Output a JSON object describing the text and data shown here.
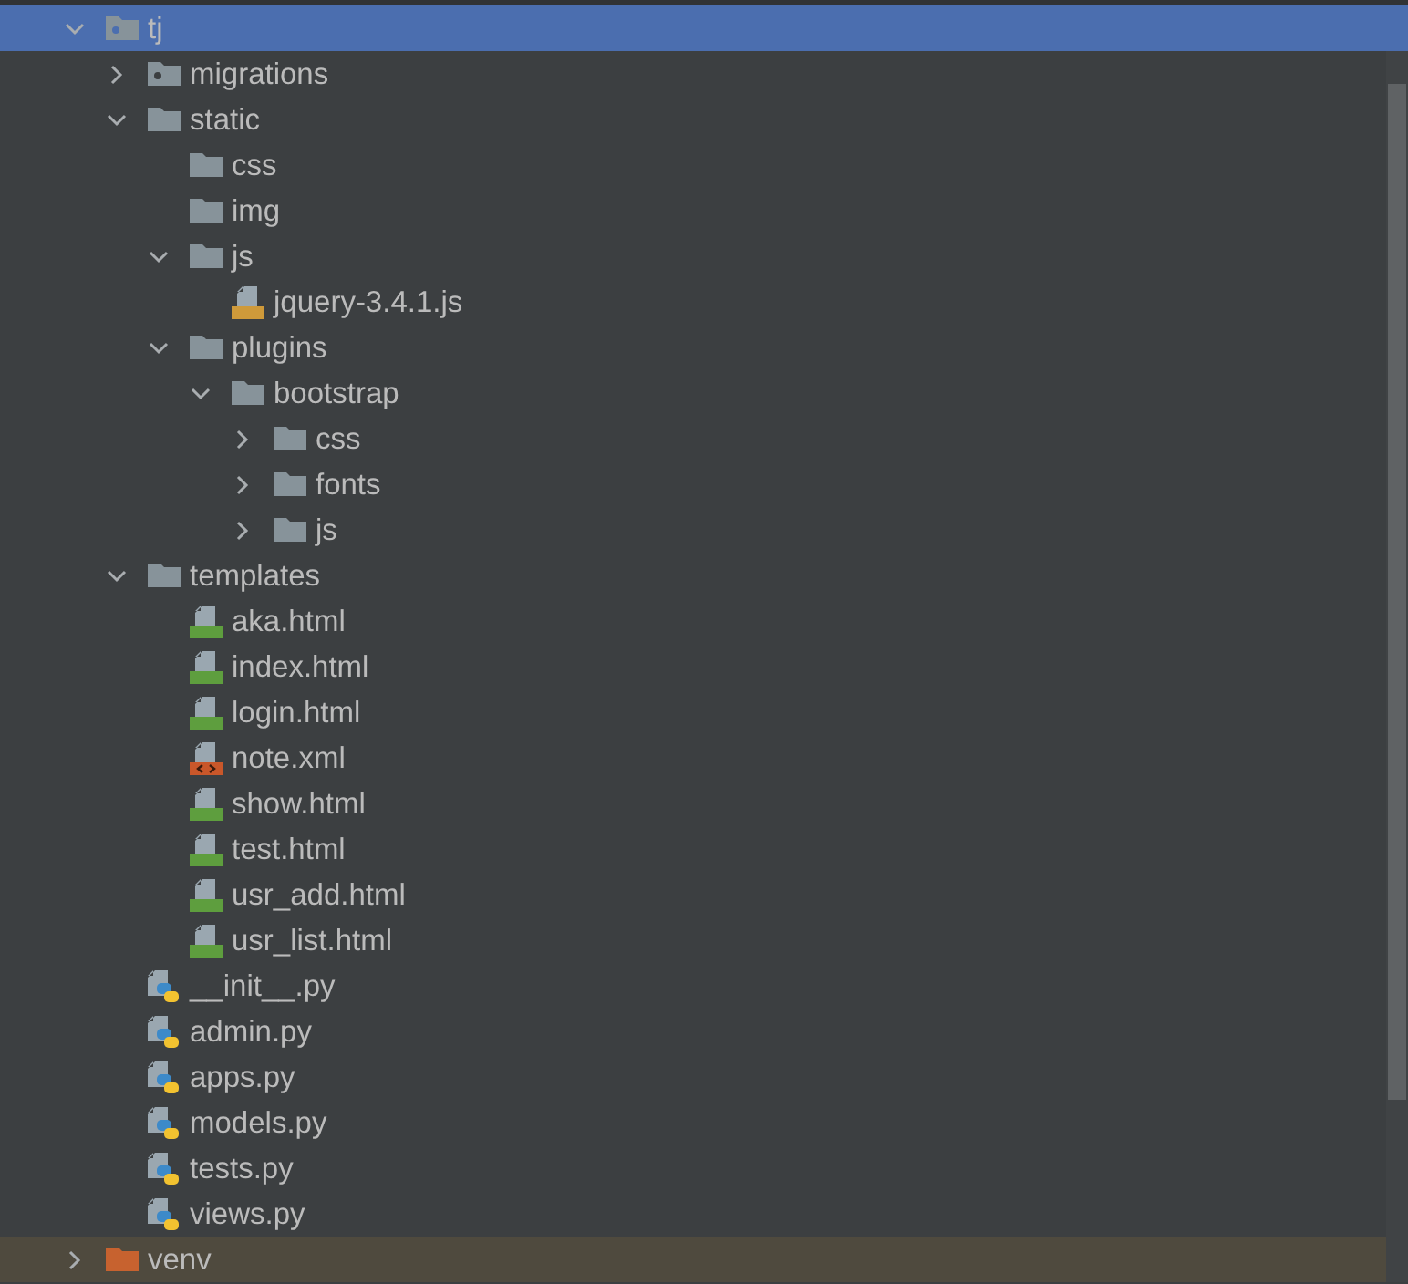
{
  "project_tree": [
    {
      "label": "tj",
      "kind": "package",
      "selected": true,
      "expanded": true,
      "children": [
        {
          "label": "migrations",
          "kind": "package",
          "selected": false,
          "expanded": false
        },
        {
          "label": "static",
          "kind": "folder",
          "selected": false,
          "expanded": true,
          "children": [
            {
              "label": "css",
              "kind": "folder",
              "selected": false
            },
            {
              "label": "img",
              "kind": "folder",
              "selected": false
            },
            {
              "label": "js",
              "kind": "folder",
              "selected": false,
              "expanded": true,
              "children": [
                {
                  "label": "jquery-3.4.1.js",
                  "kind": "js",
                  "selected": false
                }
              ]
            },
            {
              "label": "plugins",
              "kind": "folder",
              "selected": false,
              "expanded": true,
              "children": [
                {
                  "label": "bootstrap",
                  "kind": "folder",
                  "selected": false,
                  "expanded": true,
                  "children": [
                    {
                      "label": "css",
                      "kind": "folder",
                      "selected": false,
                      "expanded": false
                    },
                    {
                      "label": "fonts",
                      "kind": "folder",
                      "selected": false,
                      "expanded": false
                    },
                    {
                      "label": "js",
                      "kind": "folder",
                      "selected": false,
                      "expanded": false
                    }
                  ]
                }
              ]
            }
          ]
        },
        {
          "label": "templates",
          "kind": "folder",
          "selected": false,
          "expanded": true,
          "children": [
            {
              "label": "aka.html",
              "kind": "html",
              "selected": false
            },
            {
              "label": "index.html",
              "kind": "html",
              "selected": false
            },
            {
              "label": "login.html",
              "kind": "html",
              "selected": false
            },
            {
              "label": "note.xml",
              "kind": "xml",
              "selected": false
            },
            {
              "label": "show.html",
              "kind": "html",
              "selected": false
            },
            {
              "label": "test.html",
              "kind": "html",
              "selected": false
            },
            {
              "label": "usr_add.html",
              "kind": "html",
              "selected": false
            },
            {
              "label": "usr_list.html",
              "kind": "html",
              "selected": false
            }
          ]
        },
        {
          "label": "__init__.py",
          "kind": "python",
          "selected": false
        },
        {
          "label": "admin.py",
          "kind": "python",
          "selected": false
        },
        {
          "label": "apps.py",
          "kind": "python",
          "selected": false
        },
        {
          "label": "models.py",
          "kind": "python",
          "selected": false
        },
        {
          "label": "tests.py",
          "kind": "python",
          "selected": false
        },
        {
          "label": "views.py",
          "kind": "python",
          "selected": false
        }
      ]
    },
    {
      "label": "venv",
      "kind": "excluded_folder",
      "selected": false,
      "expanded": false
    }
  ]
}
